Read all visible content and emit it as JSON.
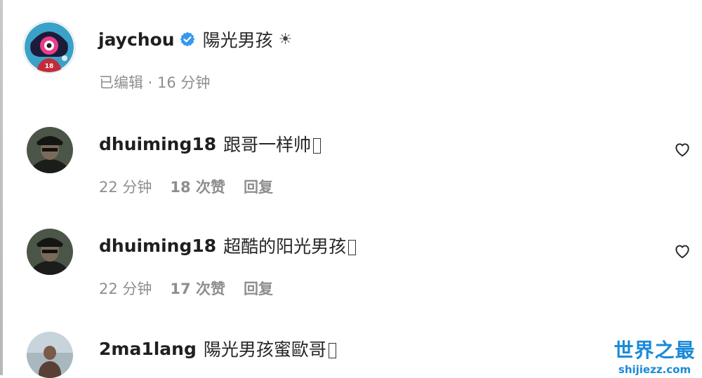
{
  "caption": {
    "username": "jaychou",
    "verified_icon": "verified-badge-icon",
    "text": "陽光男孩",
    "emoji": "☀",
    "meta": "已编辑 · 16 分钟"
  },
  "comments": [
    {
      "username": "dhuiming18",
      "text": "跟哥一样帅",
      "time": "22 分钟",
      "likes": "18 次赞",
      "reply": "回复"
    },
    {
      "username": "dhuiming18",
      "text": "超酷的阳光男孩",
      "time": "22 分钟",
      "likes": "17 次赞",
      "reply": "回复"
    },
    {
      "username": "2ma1lang",
      "text": "陽光男孩蜜歐哥"
    }
  ],
  "watermark": {
    "title": "世界之最",
    "url": "shijiezz.com"
  },
  "colors": {
    "text": "#262626",
    "meta": "#8e8e8e",
    "verified": "#3897f0",
    "watermark": "#1a8ad8"
  }
}
